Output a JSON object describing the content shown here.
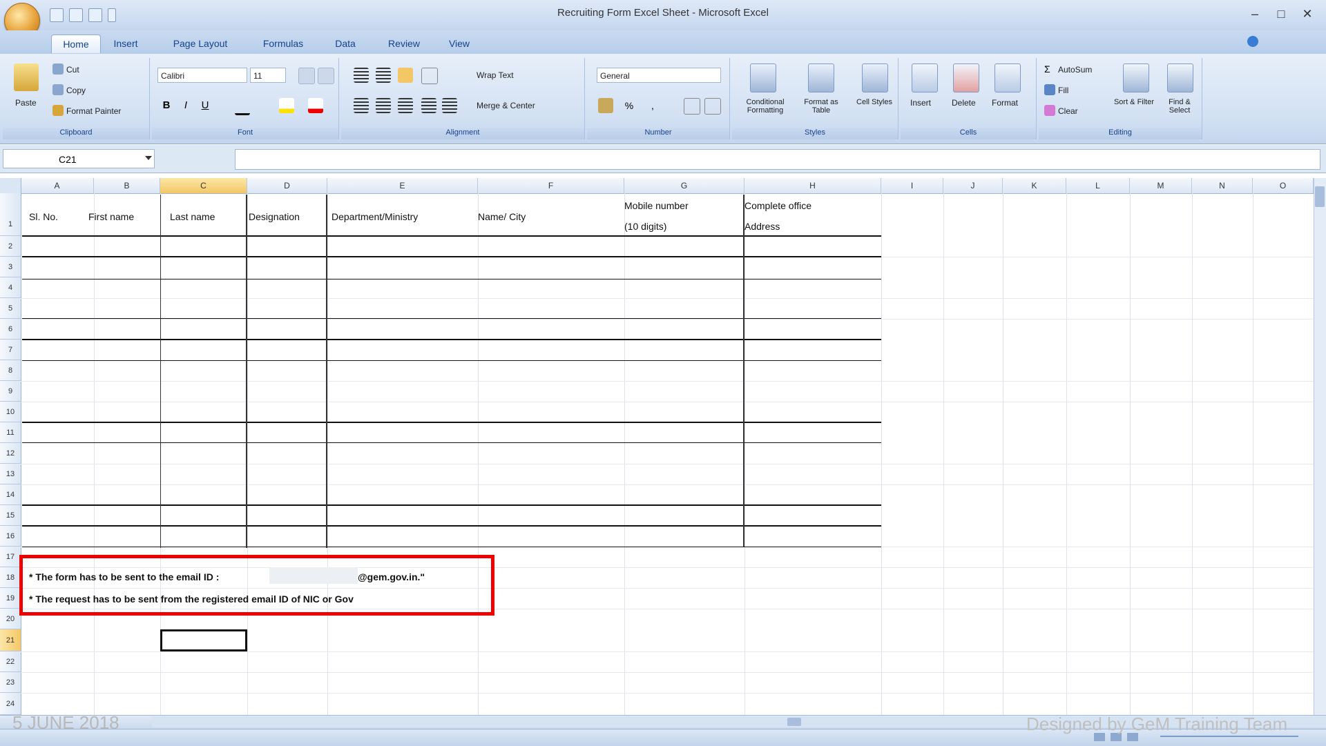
{
  "window": {
    "title": "Recruiting Form Excel Sheet - Microsoft Excel",
    "controls": [
      "–",
      "□",
      "✕"
    ]
  },
  "ribbon": {
    "tabs": [
      "Home",
      "Insert",
      "Page Layout",
      "Formulas",
      "Data",
      "Review",
      "View"
    ],
    "groups": {
      "clipboard": {
        "label": "Clipboard",
        "paste": "Paste",
        "cut": "Cut",
        "copy": "Copy",
        "format_painter": "Format Painter"
      },
      "font": {
        "label": "Font",
        "font_name": "Calibri",
        "font_size": "11"
      },
      "alignment": {
        "label": "Alignment",
        "wrap_text": "Wrap Text",
        "merge_center": "Merge & Center"
      },
      "number": {
        "label": "Number",
        "format": "General"
      },
      "styles": {
        "label": "Styles",
        "conditional": "Conditional Formatting",
        "format_table": "Format as Table",
        "cell_styles": "Cell Styles"
      },
      "cells": {
        "label": "Cells",
        "insert": "Insert",
        "delete": "Delete",
        "format": "Format"
      },
      "editing": {
        "label": "Editing",
        "autosum": "AutoSum",
        "fill": "Fill",
        "clear": "Clear",
        "sort": "Sort & Filter",
        "find": "Find & Select"
      }
    }
  },
  "formula_bar": {
    "name_box": "C21",
    "formula": ""
  },
  "grid": {
    "columns": [
      "A",
      "B",
      "C",
      "D",
      "E",
      "F",
      "G",
      "H",
      "I",
      "J",
      "K",
      "L",
      "M",
      "N",
      "O"
    ],
    "selected_column": "C",
    "rows": [
      "1",
      "2",
      "3",
      "4",
      "5",
      "6",
      "7",
      "8",
      "9",
      "10",
      "11",
      "12",
      "13",
      "14",
      "15",
      "16",
      "17",
      "18",
      "19",
      "20",
      "21",
      "22",
      "23",
      "24"
    ],
    "selected_row": "21",
    "headers": {
      "sno": "Sl. No.",
      "first_name": "First name",
      "last_name": "Last name",
      "designation": "Designation",
      "department": "Department/Ministry",
      "name_city": "Name/ City",
      "mobile": "Mobile number",
      "mobile_sub": "(10 digits)",
      "office": "Complete office",
      "office_sub": "Address"
    }
  },
  "notes": {
    "line1_a": "* The form has to be sent to the email ID :",
    "line1_b": "@gem.gov.in.\"",
    "line2": "* The request has to be sent from the registered email ID of NIC or Gov"
  },
  "sheet": {
    "footer_left": "5 JUNE 2018",
    "footer_right": "Designed by GeM Training Team"
  },
  "colors": {
    "highlight_border": "#e00000",
    "ribbon_text": "#15428b"
  }
}
